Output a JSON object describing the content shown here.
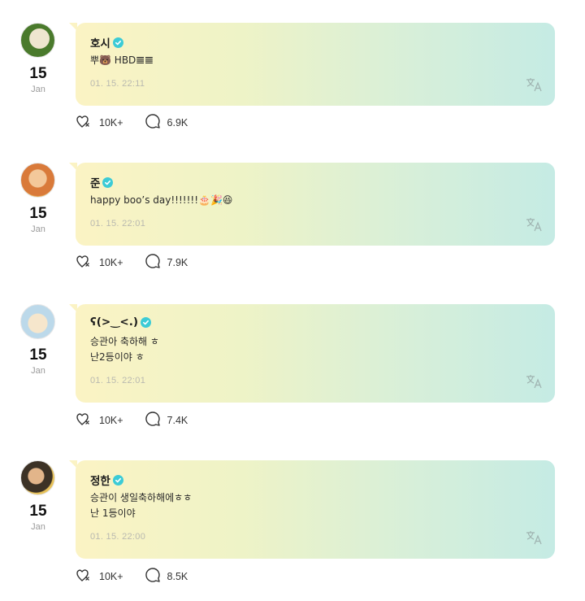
{
  "posts": [
    {
      "author": "호시",
      "body": "뿌🐻 HBD𝌆𝌆",
      "timestamp": "01. 15. 22:11",
      "date_day": "15",
      "date_month": "Jan",
      "likes": "10K+",
      "comments": "6.9K",
      "avatar_colors": [
        "#4a7a2c",
        "#e9e2c8"
      ]
    },
    {
      "author": "준",
      "body": "happy boo’s day!!!!!!!🎂🎉😆",
      "timestamp": "01. 15. 22:01",
      "date_day": "15",
      "date_month": "Jan",
      "likes": "10K+",
      "comments": "7.9K",
      "avatar_colors": [
        "#d97a3a",
        "#f0b46a"
      ]
    },
    {
      "author": "ʕ(>‿<.)",
      "body": "승관아 축하해 ㅎ\n난2등이야 ㅎ",
      "timestamp": "01. 15. 22:01",
      "date_day": "15",
      "date_month": "Jan",
      "likes": "10K+",
      "comments": "7.4K",
      "avatar_colors": [
        "#bcd9ea",
        "#f3e3c6"
      ]
    },
    {
      "author": "정한",
      "body": "승관이 생일축하해에ㅎㅎ\n난 1등이야",
      "timestamp": "01. 15. 22:00",
      "date_day": "15",
      "date_month": "Jan",
      "likes": "10K+",
      "comments": "8.5K",
      "avatar_colors": [
        "#3c3226",
        "#e7c25a"
      ]
    }
  ],
  "icons": {
    "verified": "verified-badge-icon",
    "translate": "translate-icon",
    "like": "like-icon",
    "comment": "comment-icon"
  },
  "colors": {
    "verified": "#3ccbd6",
    "bubble_start": "#fbf3c4",
    "bubble_end": "#c5ebe4"
  }
}
